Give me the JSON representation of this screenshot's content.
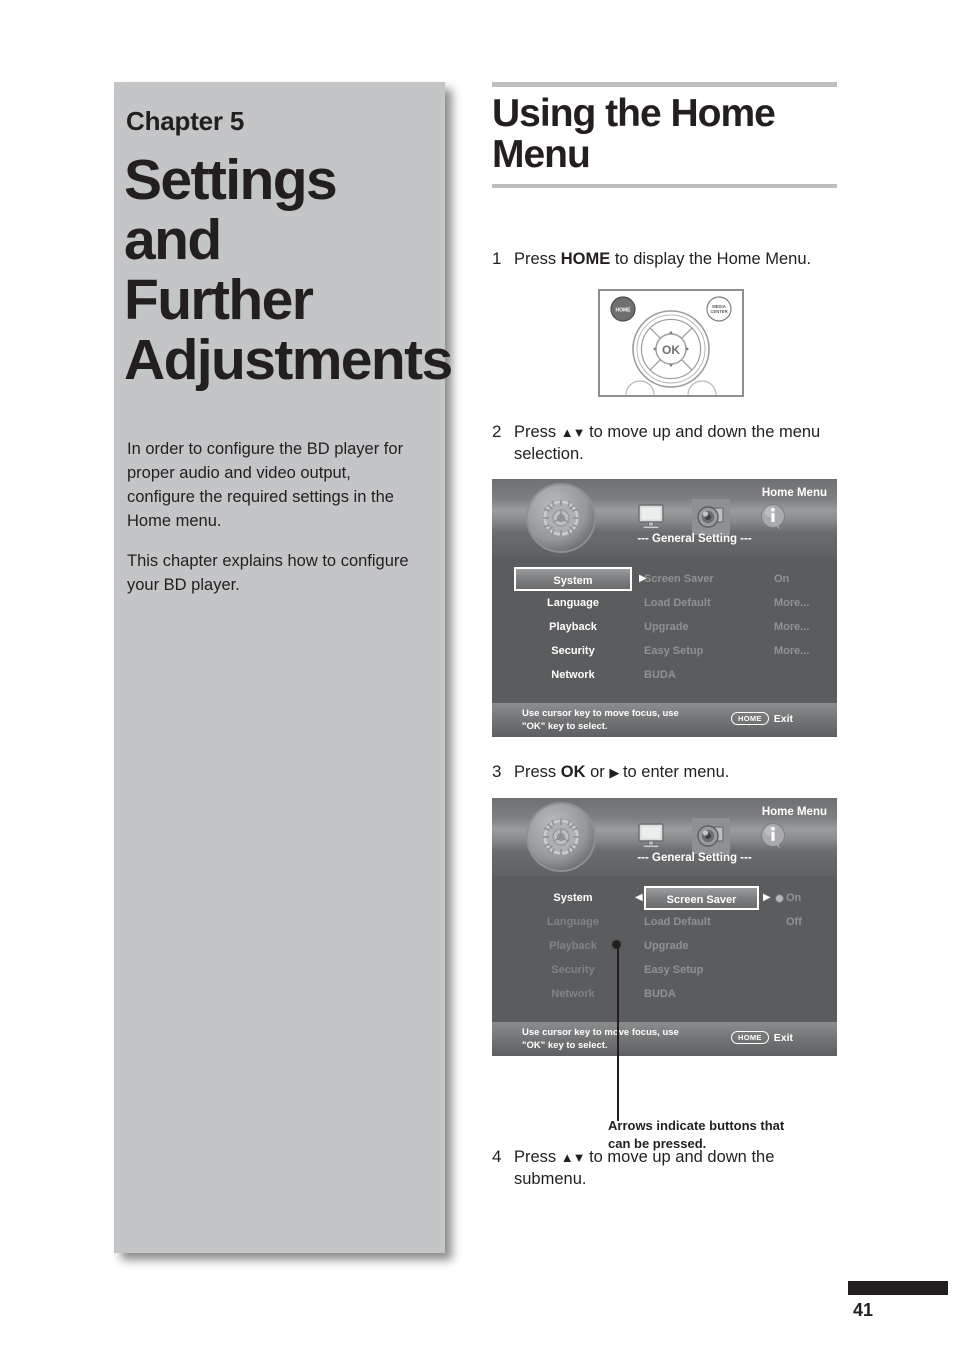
{
  "chapter": {
    "label": "Chapter 5",
    "title_lines": [
      "Settings",
      "and Further",
      "Adjustments"
    ],
    "paragraphs": [
      "In order to configure the BD player for proper audio and video output, configure the required settings in the Home menu.",
      "This chapter explains how to configure your BD player."
    ]
  },
  "heading": {
    "lines": [
      "Using the Home",
      "Menu"
    ]
  },
  "steps": [
    {
      "num": "1",
      "prefix": "Press ",
      "bold": "HOME",
      "suffix": " to display the Home Menu."
    },
    {
      "num": "2",
      "prefix": "Press ",
      "glyph": "▲▼",
      "suffix": " to move up and down the menu selection."
    },
    {
      "num": "3",
      "prefix": "Press ",
      "bold": "OK",
      "mid": " or ",
      "glyph": "▶",
      "suffix": " to enter menu."
    },
    {
      "num": "4",
      "prefix": "Press ",
      "glyph": "▲▼",
      "suffix": " to move up and down the submenu."
    }
  ],
  "remote": {
    "home_button": "HOME",
    "media_button_line1": "MEDIA",
    "media_button_line2": "CENTER",
    "ok_button": "OK",
    "up_arrow": "▲",
    "down_arrow": "▼",
    "left_arrow": "◀",
    "right_arrow": "▶"
  },
  "menu_screen_1": {
    "title": "Home Menu",
    "section_label": "--- General Setting ---",
    "icons": [
      "gear-icon",
      "display-icon",
      "media-icon",
      "info-icon"
    ],
    "left_items": [
      "System",
      "Language",
      "Playback",
      "Security",
      "Network"
    ],
    "left_selected": "System",
    "middle_items": [
      "Screen Saver",
      "Load Default",
      "Upgrade",
      "Easy Setup",
      "BUDA"
    ],
    "right_values": [
      "On",
      "More...",
      "More...",
      "More...",
      ""
    ],
    "footer_line1": "Use cursor key to move focus, use",
    "footer_line2": "\"OK\" key to select.",
    "exit_key": "HOME",
    "exit_label": "Exit"
  },
  "menu_screen_2": {
    "title": "Home Menu",
    "section_label": "--- General Setting ---",
    "icons": [
      "gear-icon",
      "display-icon",
      "media-icon",
      "info-icon"
    ],
    "left_items": [
      "System",
      "Language",
      "Playback",
      "Security",
      "Network"
    ],
    "left_active": "System",
    "middle_items": [
      "Screen Saver",
      "Load Default",
      "Upgrade",
      "Easy Setup",
      "BUDA"
    ],
    "middle_selected": "Screen Saver",
    "right_values": [
      "On",
      "Off",
      "",
      "",
      ""
    ],
    "footer_line1": "Use cursor key to move focus, use",
    "footer_line2": "\"OK\" key to select.",
    "exit_key": "HOME",
    "exit_label": "Exit"
  },
  "callout": {
    "line1": "Arrows indicate buttons that",
    "line2": "can be pressed."
  },
  "footer": {
    "page_number": "41"
  },
  "colors": {
    "panel_gray": "#c3c5c7",
    "rule_gray": "#bcbec0",
    "ink": "#231f20",
    "tv_bg": "#5a5c5e"
  }
}
